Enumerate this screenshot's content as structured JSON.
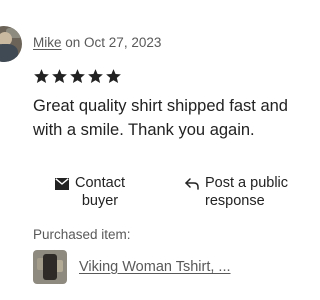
{
  "review": {
    "username": "Mike",
    "date_text": "on Oct 27, 2023",
    "rating": 5,
    "rating_max": 5,
    "text": "Great quality shirt shipped fast and with a smile. Thank you again."
  },
  "actions": {
    "contact_line1": "Contact",
    "contact_line2": "buyer",
    "post_line1": "Post a public",
    "post_line2": "response"
  },
  "purchased": {
    "label": "Purchased item:",
    "item_title": "Viking Woman Tshirt, ..."
  },
  "icons": {
    "star": "star-icon",
    "mail": "mail-icon",
    "reply": "reply-icon"
  },
  "colors": {
    "text": "#222222",
    "muted": "#595959",
    "star": "#222222"
  }
}
